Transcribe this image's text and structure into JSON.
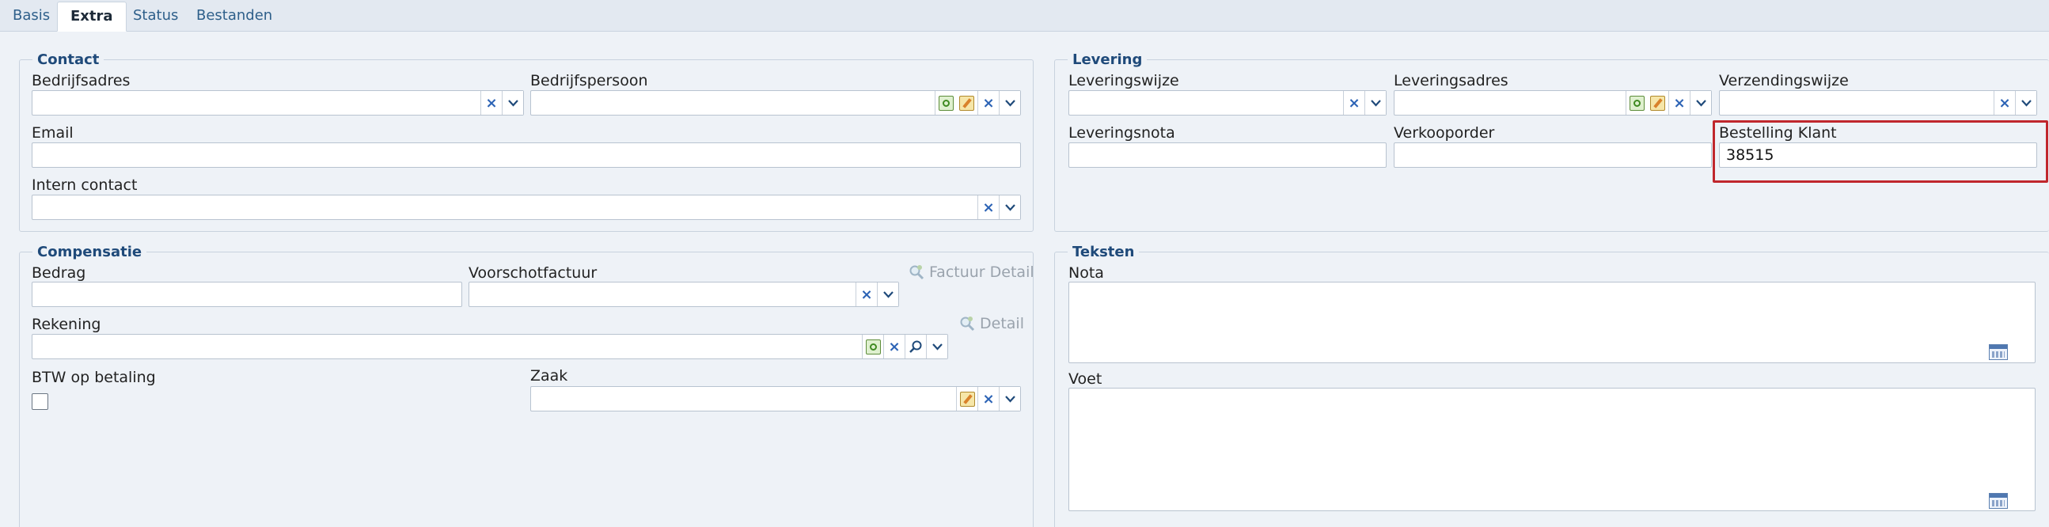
{
  "tabs": [
    {
      "label": "Basis",
      "active": false
    },
    {
      "label": "Extra",
      "active": true
    },
    {
      "label": "Status",
      "active": false
    },
    {
      "label": "Bestanden",
      "active": false
    }
  ],
  "contact": {
    "legend": "Contact",
    "bedrijfsadres": {
      "label": "Bedrijfsadres",
      "value": ""
    },
    "bedrijfspersoon": {
      "label": "Bedrijfspersoon",
      "value": ""
    },
    "email": {
      "label": "Email",
      "value": ""
    },
    "intern_contact": {
      "label": "Intern contact",
      "value": ""
    }
  },
  "levering": {
    "legend": "Levering",
    "leveringswijze": {
      "label": "Leveringswijze",
      "value": ""
    },
    "leveringsadres": {
      "label": "Leveringsadres",
      "value": ""
    },
    "verzendingswijze": {
      "label": "Verzendingswijze",
      "value": ""
    },
    "leveringsnota": {
      "label": "Leveringsnota",
      "value": ""
    },
    "verkooporder": {
      "label": "Verkooporder",
      "value": ""
    },
    "bestelling_klant": {
      "label": "Bestelling Klant",
      "value": "38515"
    }
  },
  "compensatie": {
    "legend": "Compensatie",
    "bedrag": {
      "label": "Bedrag",
      "value": ""
    },
    "voorschotfactuur": {
      "label": "Voorschotfactuur",
      "value": ""
    },
    "factuur_detail_label": "Factuur Detail",
    "rekening": {
      "label": "Rekening",
      "value": ""
    },
    "detail_label": "Detail",
    "btw_op_betaling": {
      "label": "BTW op betaling",
      "checked": false
    },
    "zaak": {
      "label": "Zaak",
      "value": ""
    }
  },
  "teksten": {
    "legend": "Teksten",
    "nota": {
      "label": "Nota",
      "value": ""
    },
    "voet": {
      "label": "Voet",
      "value": ""
    }
  },
  "icons": {
    "clear": "×",
    "highlight_color": "#c0272d"
  }
}
